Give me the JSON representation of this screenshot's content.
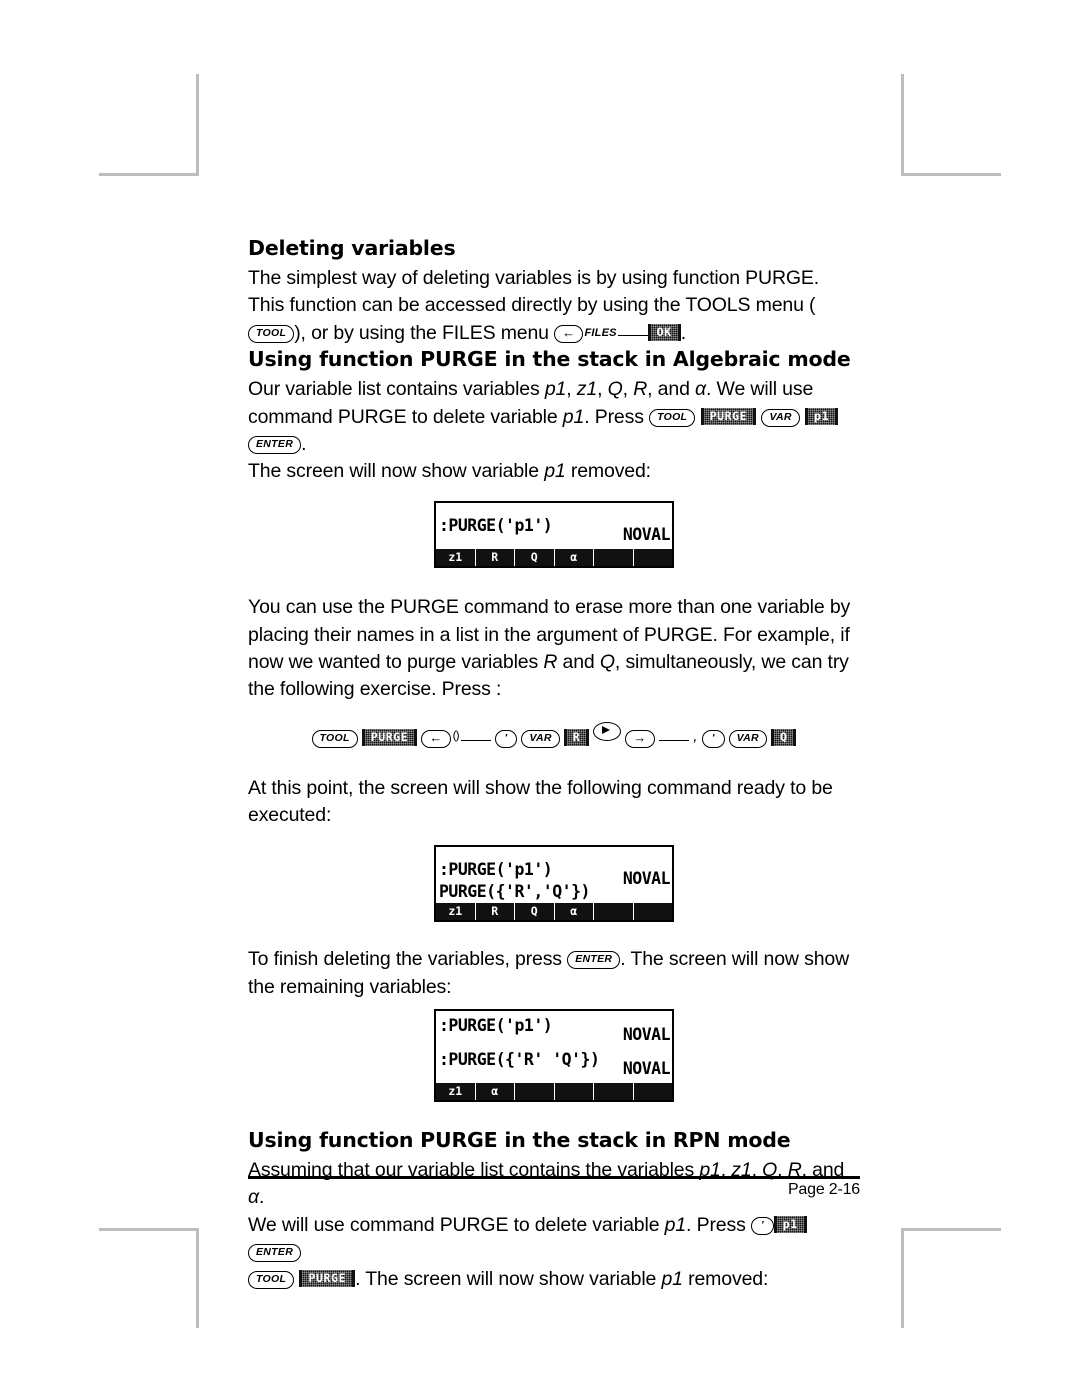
{
  "document": {
    "footer_page": "Page 2-16"
  },
  "sections": {
    "deleting_variables": {
      "heading": "Deleting variables",
      "p1_a": "The simplest way of deleting variables is by using function PURGE.  This function can be accessed directly by using the TOOLS menu (",
      "p1_b": "), or by using the FILES menu ",
      "p1_c": "."
    },
    "algebraic": {
      "heading": "Using function PURGE in the stack in Algebraic mode",
      "p1_a": "Our variable list contains variables ",
      "p1_v1": "p1",
      "p1_sep1": ", ",
      "p1_v2": "z1",
      "p1_sep2": ", ",
      "p1_v3": "Q",
      "p1_sep3": ", ",
      "p1_v4": "R",
      "p1_sep4": ", and ",
      "p1_v5": "α",
      "p1_b": ".  We will use command PURGE to delete variable ",
      "p1_v6": "p1",
      "p1_c": ".   Press ",
      "p1_d": ".",
      "p1_e": "The screen will now show variable ",
      "p1_v7": "p1",
      "p1_f": " removed:"
    },
    "multi_purge": {
      "p_a": "You can use the PURGE command to erase more than one variable by placing their names in a list in the argument of PURGE.  For example, if now we wanted to purge variables ",
      "p_v1": "R",
      "p_mid": " and ",
      "p_v2": "Q",
      "p_b": ", simultaneously, we can try the following exercise.  Press :"
    },
    "ready": {
      "p": "At this point, the screen will show the following command ready to be executed:"
    },
    "finish": {
      "p_a": "To finish deleting the variables, press ",
      "p_b": ".   The screen will now show the remaining variables:"
    },
    "rpn": {
      "heading": "Using function PURGE in the stack in RPN mode",
      "p1_a": "Assuming that our variable list contains the variables ",
      "p1_v1": "p1",
      "p1_s1": ", ",
      "p1_v2": "z1",
      "p1_s2": ", ",
      "p1_v3": "Q",
      "p1_s3": ", ",
      "p1_v4": "R",
      "p1_s4": ", and ",
      "p1_v5": "α",
      "p1_b": ".",
      "p2_a": "We will use command PURGE to delete variable ",
      "p2_v1": "p1",
      "p2_b": ".   Press ",
      "p3_a": ".   The screen will now show variable ",
      "p3_v1": "p1",
      "p3_b": " removed:"
    }
  },
  "keys": {
    "tool": "TOOL",
    "enter": "ENTER",
    "var": "VAR",
    "tick": "'",
    "left_shift": "←",
    "right_shift": "→",
    "files_label": "FILES",
    "paren_label": "()",
    "comma_label": ",",
    "ok_soft": "OK",
    "purge_soft": "PURGE",
    "p1_soft": "p1",
    "r_soft": "R",
    "q_soft": "Q"
  },
  "key_sequences": {
    "files_menu": [
      {
        "type": "keycap-arrow",
        "name": "left-shift-key",
        "label": "←"
      },
      {
        "type": "annot",
        "name": "files-annotation",
        "label": "FILES"
      },
      {
        "type": "underline",
        "name": "key-underline"
      },
      {
        "type": "softkey",
        "name": "ok-softkey",
        "label": "OK"
      }
    ],
    "algebraic_purge": [
      {
        "type": "keycap",
        "name": "tool-key",
        "label": "TOOL"
      },
      {
        "type": "softkey",
        "name": "purge-softkey",
        "label": "PURGE"
      },
      {
        "type": "keycap",
        "name": "var-key",
        "label": "VAR"
      },
      {
        "type": "softkey",
        "name": "p1-softkey",
        "label": "p1"
      },
      {
        "type": "keycap",
        "name": "enter-key",
        "label": "ENTER"
      }
    ],
    "multi_purge_row": [
      {
        "type": "keycap",
        "name": "tool-key",
        "label": "TOOL"
      },
      {
        "type": "softkey",
        "name": "purge-softkey",
        "label": "PURGE"
      },
      {
        "type": "keycap-arrow",
        "name": "left-shift-key",
        "label": "←"
      },
      {
        "type": "paren",
        "name": "paren-annotation",
        "label": "()"
      },
      {
        "type": "underline",
        "name": "key-underline"
      },
      {
        "type": "keycap",
        "name": "tick-key",
        "label": "'"
      },
      {
        "type": "keycap",
        "name": "var-key",
        "label": "VAR"
      },
      {
        "type": "softkey",
        "name": "r-softkey",
        "label": "R"
      },
      {
        "type": "round",
        "name": "right-arrow-key"
      },
      {
        "type": "keycap-arrow",
        "name": "right-shift-key",
        "label": "→"
      },
      {
        "type": "underline",
        "name": "key-underline"
      },
      {
        "type": "annot",
        "name": "comma-annotation",
        "label": ","
      },
      {
        "type": "keycap",
        "name": "tick-key",
        "label": "'"
      },
      {
        "type": "keycap",
        "name": "var-key",
        "label": "VAR"
      },
      {
        "type": "softkey",
        "name": "q-softkey",
        "label": "Q"
      }
    ],
    "rpn_line2": [
      {
        "type": "keycap",
        "name": "tick-key",
        "label": "'"
      },
      {
        "type": "softkey",
        "name": "p1-softkey",
        "label": "p1"
      },
      {
        "type": "keycap",
        "name": "enter-key",
        "label": "ENTER"
      }
    ],
    "rpn_line3": [
      {
        "type": "keycap",
        "name": "tool-key",
        "label": "TOOL"
      },
      {
        "type": "softkey",
        "name": "purge-softkey",
        "label": "PURGE"
      }
    ]
  },
  "screens": {
    "screen1": {
      "lines": [
        {
          "text": ":PURGE('p1')",
          "value": "NOVAL"
        }
      ],
      "menu": [
        "z1",
        "R",
        "Q",
        "α",
        "",
        ""
      ]
    },
    "screen2": {
      "lines": [
        {
          "text": ":PURGE('p1')",
          "value": "NOVAL"
        },
        {
          "text": "PURGE({'R','Q'})",
          "value": ""
        }
      ],
      "menu": [
        "z1",
        "R",
        "Q",
        "α",
        "",
        ""
      ]
    },
    "screen3": {
      "lines": [
        {
          "text": ":PURGE('p1')",
          "value": "NOVAL"
        },
        {
          "text": ":PURGE({'R' 'Q'})",
          "value": "NOVAL"
        }
      ],
      "menu": [
        "z1",
        "α",
        "",
        "",
        "",
        ""
      ]
    }
  }
}
